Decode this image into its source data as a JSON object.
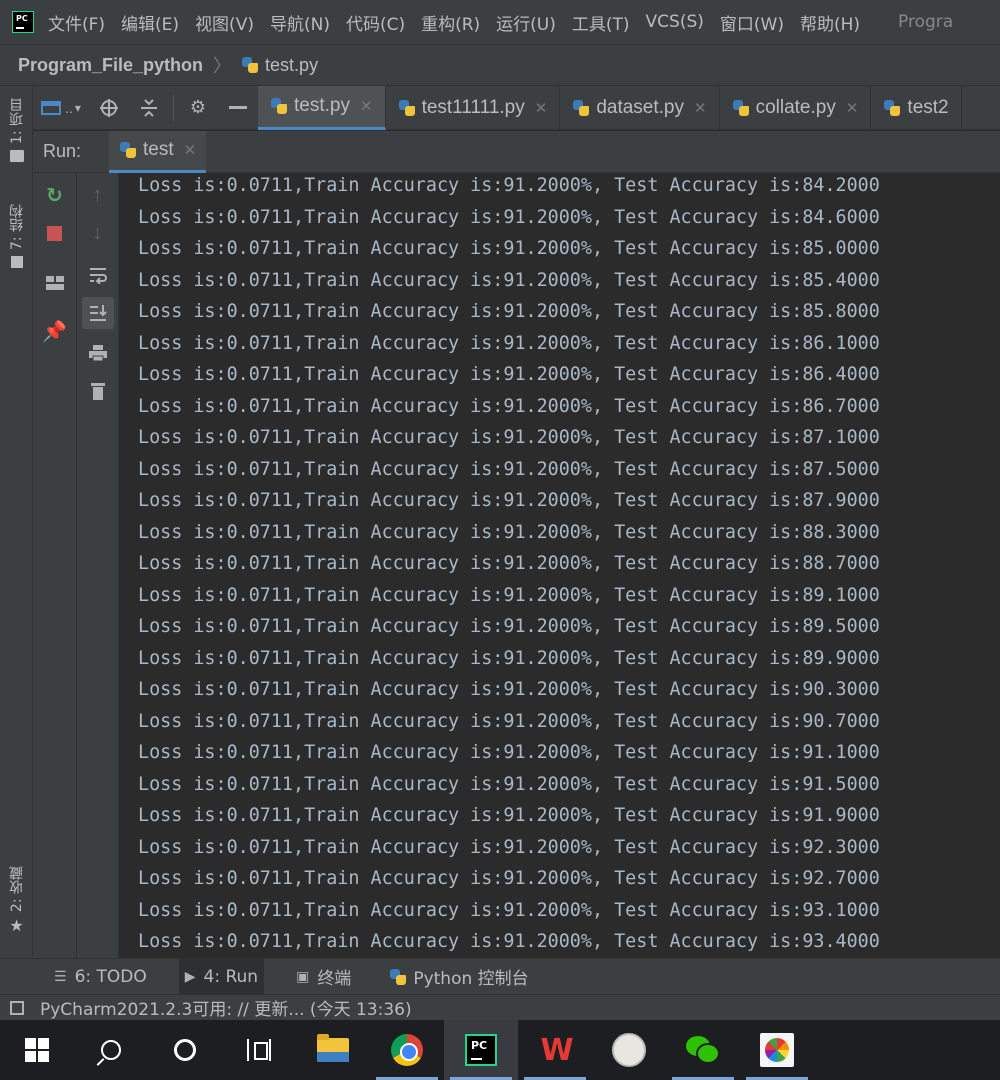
{
  "menubar": {
    "logo_text": "PC",
    "items": [
      "文件(F)",
      "编辑(E)",
      "视图(V)",
      "导航(N)",
      "代码(C)",
      "重构(R)",
      "运行(U)",
      "工具(T)",
      "VCS(S)",
      "窗口(W)",
      "帮助(H)"
    ],
    "title_partial": "Progra"
  },
  "breadcrumb": {
    "project": "Program_File_python",
    "file": "test.py"
  },
  "left_strip": {
    "project_tab": "1: 项目",
    "structure_tab": "7: 结构",
    "favorites_tab": "2: 收藏"
  },
  "editor_tabs": {
    "toolbar_first_label": "..",
    "tabs": [
      {
        "label": "test.py",
        "active": true
      },
      {
        "label": "test11111.py",
        "active": false
      },
      {
        "label": "dataset.py",
        "active": false
      },
      {
        "label": "collate.py",
        "active": false
      },
      {
        "label": "test2",
        "active": false
      }
    ]
  },
  "run_panel": {
    "label": "Run:",
    "config_name": "test"
  },
  "console": {
    "lines": [
      "Loss is:0.0711,Train Accuracy is:91.2000%, Test Accuracy is:84.2000",
      "Loss is:0.0711,Train Accuracy is:91.2000%, Test Accuracy is:84.6000",
      "Loss is:0.0711,Train Accuracy is:91.2000%, Test Accuracy is:85.0000",
      "Loss is:0.0711,Train Accuracy is:91.2000%, Test Accuracy is:85.4000",
      "Loss is:0.0711,Train Accuracy is:91.2000%, Test Accuracy is:85.8000",
      "Loss is:0.0711,Train Accuracy is:91.2000%, Test Accuracy is:86.1000",
      "Loss is:0.0711,Train Accuracy is:91.2000%, Test Accuracy is:86.4000",
      "Loss is:0.0711,Train Accuracy is:91.2000%, Test Accuracy is:86.7000",
      "Loss is:0.0711,Train Accuracy is:91.2000%, Test Accuracy is:87.1000",
      "Loss is:0.0711,Train Accuracy is:91.2000%, Test Accuracy is:87.5000",
      "Loss is:0.0711,Train Accuracy is:91.2000%, Test Accuracy is:87.9000",
      "Loss is:0.0711,Train Accuracy is:91.2000%, Test Accuracy is:88.3000",
      "Loss is:0.0711,Train Accuracy is:91.2000%, Test Accuracy is:88.7000",
      "Loss is:0.0711,Train Accuracy is:91.2000%, Test Accuracy is:89.1000",
      "Loss is:0.0711,Train Accuracy is:91.2000%, Test Accuracy is:89.5000",
      "Loss is:0.0711,Train Accuracy is:91.2000%, Test Accuracy is:89.9000",
      "Loss is:0.0711,Train Accuracy is:91.2000%, Test Accuracy is:90.3000",
      "Loss is:0.0711,Train Accuracy is:91.2000%, Test Accuracy is:90.7000",
      "Loss is:0.0711,Train Accuracy is:91.2000%, Test Accuracy is:91.1000",
      "Loss is:0.0711,Train Accuracy is:91.2000%, Test Accuracy is:91.5000",
      "Loss is:0.0711,Train Accuracy is:91.2000%, Test Accuracy is:91.9000",
      "Loss is:0.0711,Train Accuracy is:91.2000%, Test Accuracy is:92.3000",
      "Loss is:0.0711,Train Accuracy is:91.2000%, Test Accuracy is:92.7000",
      "Loss is:0.0711,Train Accuracy is:91.2000%, Test Accuracy is:93.1000",
      "Loss is:0.0711,Train Accuracy is:91.2000%, Test Accuracy is:93.4000"
    ]
  },
  "bottom_tabs": [
    {
      "label": "6: TODO",
      "icon": "list-icon"
    },
    {
      "label": "4: Run",
      "icon": "play-icon",
      "active": true
    },
    {
      "label": "终端",
      "icon": "terminal-icon"
    },
    {
      "label": "Python 控制台",
      "icon": "python-icon"
    }
  ],
  "status": {
    "text": "PyCharm2021.2.3可用: // 更新... (今天 13:36)"
  },
  "taskbar": {
    "pc_label": "PC"
  },
  "colors": {
    "background": "#2b2b2b",
    "panel": "#3c3f41",
    "console_text": "#a9b7c6",
    "accent": "#4a88c7",
    "rerun": "#59a869",
    "stop": "#c75450"
  }
}
